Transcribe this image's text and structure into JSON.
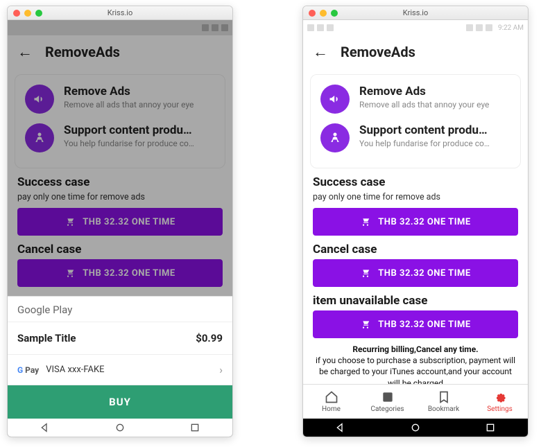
{
  "window_title": "Kriss.io",
  "statusbar": {
    "time": "9:22 AM"
  },
  "appbar": {
    "title": "RemoveAds"
  },
  "features": [
    {
      "icon": "megaphone",
      "title": "Remove Ads",
      "sub": "Remove all ads that annoy your eye"
    },
    {
      "icon": "person",
      "title": "Support content produ…",
      "sub": "You help fundarise for  produce co…"
    }
  ],
  "sections": {
    "success": {
      "heading": "Success case",
      "sub": "pay only one time for remove ads",
      "btn": "THB 32.32 ONE TIME"
    },
    "cancel": {
      "heading": "Cancel case",
      "btn": "THB 32.32 ONE TIME"
    },
    "unavail": {
      "heading": "item unavailable case",
      "btn": "THB 32.32 ONE TIME"
    }
  },
  "fineprint": {
    "line1": "Recurring billing,Cancel any time.",
    "line2": "if you choose to purchase a subscription, payment will be charged to your iTunes account,and your account will be charged"
  },
  "tabs": [
    {
      "label": "Home"
    },
    {
      "label": "Categories"
    },
    {
      "label": "Bookmark"
    },
    {
      "label": "Settings"
    }
  ],
  "gplay": {
    "header": "Google Play",
    "item_title": "Sample Title",
    "item_price": "$0.99",
    "pay_label": "Pay",
    "pay_method": "VISA xxx-FAKE",
    "buy": "BUY"
  }
}
